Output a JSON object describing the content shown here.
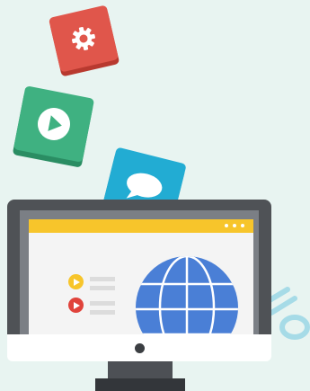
{
  "scene": {
    "background_color": "#e8f4f1"
  },
  "tiles": [
    {
      "name": "settings",
      "icon": "gear-icon",
      "color": "#e0564b"
    },
    {
      "name": "video",
      "icon": "play-icon",
      "color": "#3fb181"
    },
    {
      "name": "chat",
      "icon": "speech-bubble-icon",
      "color": "#22acd3"
    }
  ],
  "monitor": {
    "titlebar_color": "#f7c52b",
    "titlebar_dots": 3,
    "media_items": [
      {
        "icon": "play-icon",
        "color": "#f7c52b"
      },
      {
        "icon": "play-icon",
        "color": "#e0433b"
      }
    ],
    "globe_icon": "globe-icon",
    "globe_color": "#4a7fd6"
  }
}
